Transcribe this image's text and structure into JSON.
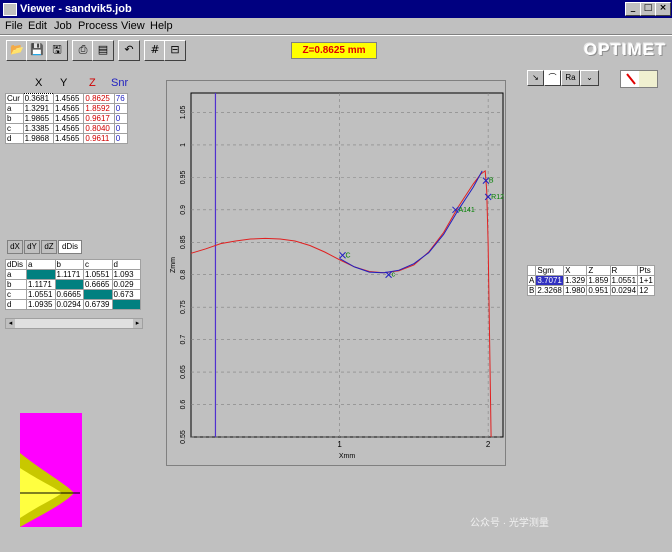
{
  "window": {
    "title": "Viewer - sandvik5.job"
  },
  "menu": [
    "File",
    "Edit",
    "Job",
    "Process",
    "View",
    "Help"
  ],
  "toolbar": {
    "z_readout": "Z=0.8625 mm",
    "brand": "OPTIMET"
  },
  "coords": {
    "headers": [
      "X",
      "Y",
      "Z",
      "Snr"
    ],
    "rows": [
      {
        "label": "Cur",
        "x": "0.3681",
        "y": "1.4565",
        "z": "0.8625",
        "snr": "76"
      },
      {
        "label": "a",
        "x": "1.3291",
        "y": "1.4565",
        "z": "1.8592",
        "snr": "0"
      },
      {
        "label": "b",
        "x": "1.9865",
        "y": "1.4565",
        "z": "0.9617",
        "snr": "0"
      },
      {
        "label": "c",
        "x": "1.3385",
        "y": "1.4565",
        "z": "0.8040",
        "snr": "0"
      },
      {
        "label": "d",
        "x": "1.9868",
        "y": "1.4565",
        "z": "0.9611",
        "snr": "0"
      }
    ]
  },
  "dist": {
    "tabs": [
      "dX",
      "dY",
      "dZ",
      "dDis"
    ],
    "headers": [
      "dDis",
      "a",
      "b",
      "c",
      "d"
    ],
    "rows": [
      {
        "label": "a",
        "cells": [
          "",
          "1.1171",
          "1.0551",
          "1.093"
        ]
      },
      {
        "label": "b",
        "cells": [
          "1.1171",
          "",
          "0.6665",
          "0.029"
        ]
      },
      {
        "label": "c",
        "cells": [
          "1.0551",
          "0.6665",
          "",
          "0.673"
        ]
      },
      {
        "label": "d",
        "cells": [
          "1.0935",
          "0.0294",
          "0.6739",
          ""
        ]
      }
    ]
  },
  "mode_buttons": [
    "↘",
    "⌒",
    "Ra",
    "⌄"
  ],
  "geometry": {
    "headers": [
      "Sgm",
      "X",
      "Z",
      "R",
      "Pts"
    ],
    "rows": [
      {
        "label": "A",
        "sgm": "3.7071",
        "x": "1.329",
        "z": "1.859",
        "r": "1.0551",
        "pts": "1+1"
      },
      {
        "label": "B",
        "sgm": "2.3268",
        "x": "1.980",
        "z": "0.951",
        "r": "0.0294",
        "pts": "12"
      }
    ]
  },
  "chart_data": {
    "type": "line",
    "xlabel": "Xmm",
    "ylabel": "Zmm",
    "x_ticks": [
      "1",
      "2"
    ],
    "y_ticks": [
      "0.55",
      "0.6",
      "0.65",
      "0.7",
      "0.75",
      "0.8",
      "0.85",
      "0.9",
      "0.95",
      "1",
      "1.05"
    ],
    "xlim": [
      0,
      2.1
    ],
    "ylim": [
      0.55,
      1.08
    ],
    "cursor_x": 0.1646,
    "profile": [
      [
        0,
        0.833
      ],
      [
        0.1,
        0.84
      ],
      [
        0.2,
        0.848
      ],
      [
        0.3,
        0.852
      ],
      [
        0.4,
        0.855
      ],
      [
        0.5,
        0.856
      ],
      [
        0.6,
        0.855
      ],
      [
        0.7,
        0.852
      ],
      [
        0.8,
        0.845
      ],
      [
        0.9,
        0.835
      ],
      [
        1.0,
        0.823
      ],
      [
        1.1,
        0.812
      ],
      [
        1.2,
        0.805
      ],
      [
        1.3,
        0.803
      ],
      [
        1.4,
        0.806
      ],
      [
        1.5,
        0.815
      ],
      [
        1.6,
        0.835
      ],
      [
        1.7,
        0.865
      ],
      [
        1.8,
        0.905
      ],
      [
        1.9,
        0.94
      ],
      [
        1.95,
        0.955
      ],
      [
        1.98,
        0.96
      ],
      [
        1.99,
        0.93
      ],
      [
        2.0,
        0.85
      ],
      [
        2.01,
        0.7
      ],
      [
        2.02,
        0.55
      ]
    ],
    "fit_arc": [
      [
        1.0,
        0.825
      ],
      [
        1.1,
        0.812
      ],
      [
        1.2,
        0.804
      ],
      [
        1.3,
        0.803
      ],
      [
        1.4,
        0.807
      ],
      [
        1.5,
        0.817
      ],
      [
        1.6,
        0.834
      ],
      [
        1.7,
        0.862
      ],
      [
        1.8,
        0.9
      ],
      [
        1.9,
        0.935
      ],
      [
        1.96,
        0.96
      ]
    ],
    "markers": [
      {
        "label": "C",
        "x": 1.02,
        "z": 0.83
      },
      {
        "label": "c",
        "x": 1.33,
        "z": 0.8
      },
      {
        "label": "A141",
        "x": 1.78,
        "z": 0.9
      },
      {
        "label": "B",
        "x": 1.985,
        "z": 0.945
      },
      {
        "label": "R12",
        "x": 2.0,
        "z": 0.92
      }
    ],
    "colors": {
      "profile": "#e02020",
      "fit": "#2020c0",
      "cursor": "#5030d0",
      "marker": "#008000"
    }
  },
  "watermark": "公众号 · 光学测量"
}
